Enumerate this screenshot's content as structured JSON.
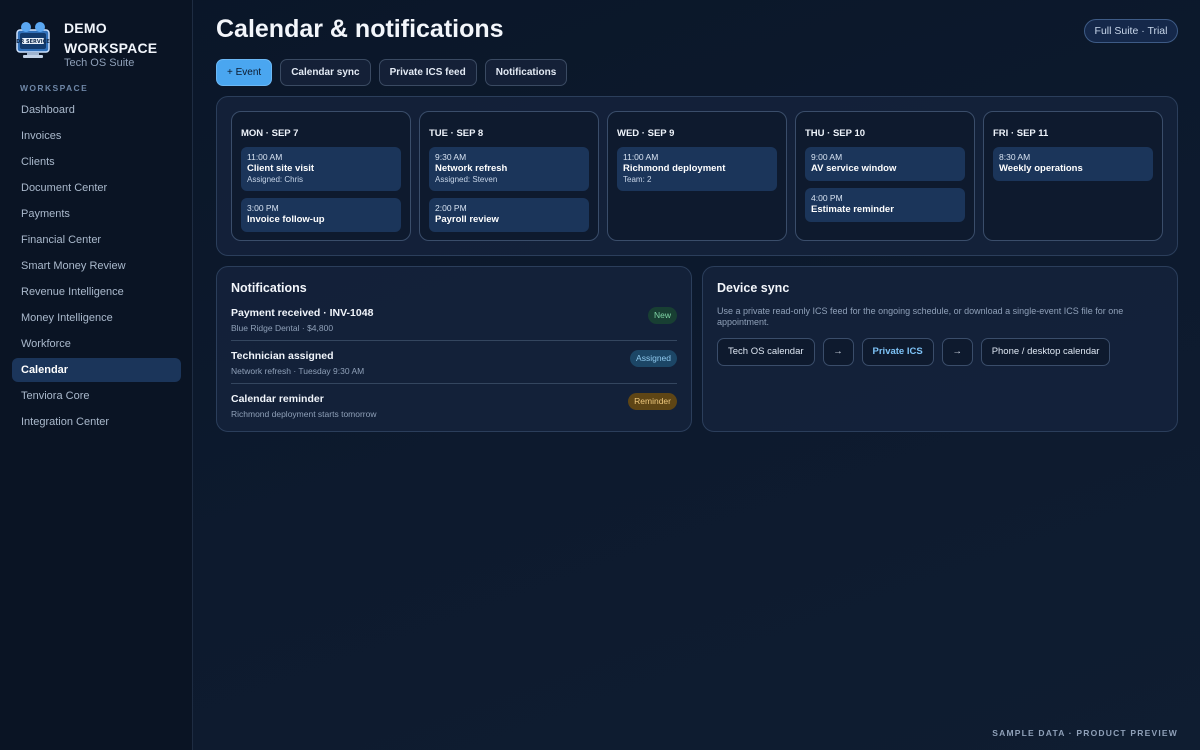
{
  "sidebar": {
    "brand_name": "DEMO WORKSPACE",
    "brand_sub": "Tech OS Suite",
    "logo_text": "DR SERVICE",
    "section_label": "WORKSPACE",
    "items": [
      {
        "label": "Dashboard",
        "active": false
      },
      {
        "label": "Invoices",
        "active": false
      },
      {
        "label": "Clients",
        "active": false
      },
      {
        "label": "Document Center",
        "active": false
      },
      {
        "label": "Payments",
        "active": false
      },
      {
        "label": "Financial Center",
        "active": false
      },
      {
        "label": "Smart Money Review",
        "active": false
      },
      {
        "label": "Revenue Intelligence",
        "active": false
      },
      {
        "label": "Money Intelligence",
        "active": false
      },
      {
        "label": "Workforce",
        "active": false
      },
      {
        "label": "Calendar",
        "active": true
      },
      {
        "label": "Tenviora Core",
        "active": false
      },
      {
        "label": "Integration Center",
        "active": false
      }
    ]
  },
  "header": {
    "title": "Calendar & notifications",
    "plan_badge": "Full Suite · Trial"
  },
  "actions": {
    "add_event": "+ Event",
    "calendar_sync": "Calendar sync",
    "private_ics": "Private ICS feed",
    "notifications": "Notifications"
  },
  "calendar": {
    "days": [
      {
        "title": "MON · SEP 7",
        "events": [
          {
            "time": "11:00 AM",
            "title": "Client site visit",
            "detail": "Assigned: Chris"
          },
          {
            "time": "3:00 PM",
            "title": "Invoice follow-up",
            "detail": ""
          }
        ]
      },
      {
        "title": "TUE · SEP 8",
        "events": [
          {
            "time": "9:30 AM",
            "title": "Network refresh",
            "detail": "Assigned: Steven"
          },
          {
            "time": "2:00 PM",
            "title": "Payroll review",
            "detail": ""
          }
        ]
      },
      {
        "title": "WED · SEP 9",
        "events": [
          {
            "time": "11:00 AM",
            "title": "Richmond deployment",
            "detail": "Team: 2"
          }
        ]
      },
      {
        "title": "THU · SEP 10",
        "events": [
          {
            "time": "9:00 AM",
            "title": "AV service window",
            "detail": ""
          },
          {
            "time": "4:00 PM",
            "title": "Estimate reminder",
            "detail": ""
          }
        ]
      },
      {
        "title": "FRI · SEP 11",
        "events": [
          {
            "time": "8:30 AM",
            "title": "Weekly operations",
            "detail": ""
          }
        ]
      }
    ]
  },
  "notifications": {
    "title": "Notifications",
    "items": [
      {
        "title": "Payment received · INV-1048",
        "detail": "Blue Ridge Dental · $4,800",
        "badge": "New"
      },
      {
        "title": "Technician assigned",
        "detail": "Network refresh · Tuesday 9:30 AM",
        "badge": "Assigned"
      },
      {
        "title": "Calendar reminder",
        "detail": "Richmond deployment starts tomorrow",
        "badge": "Reminder"
      }
    ]
  },
  "device_sync": {
    "title": "Device sync",
    "description": "Use a private read-only ICS feed for the ongoing schedule, or download a single-event ICS file for one appointment.",
    "flow": {
      "source": "Tech OS calendar",
      "arrow": "→",
      "feed": "Private ICS",
      "target": "Phone / desktop calendar"
    }
  },
  "footer": "SAMPLE DATA · PRODUCT PREVIEW",
  "colors": {
    "background": "#0b1729",
    "accent": "#4aa6f0",
    "active_nav": "#1b355a",
    "badge_new": "#7fd6a6",
    "badge_assigned": "#8fc9ee",
    "badge_reminder": "#eec77c"
  }
}
